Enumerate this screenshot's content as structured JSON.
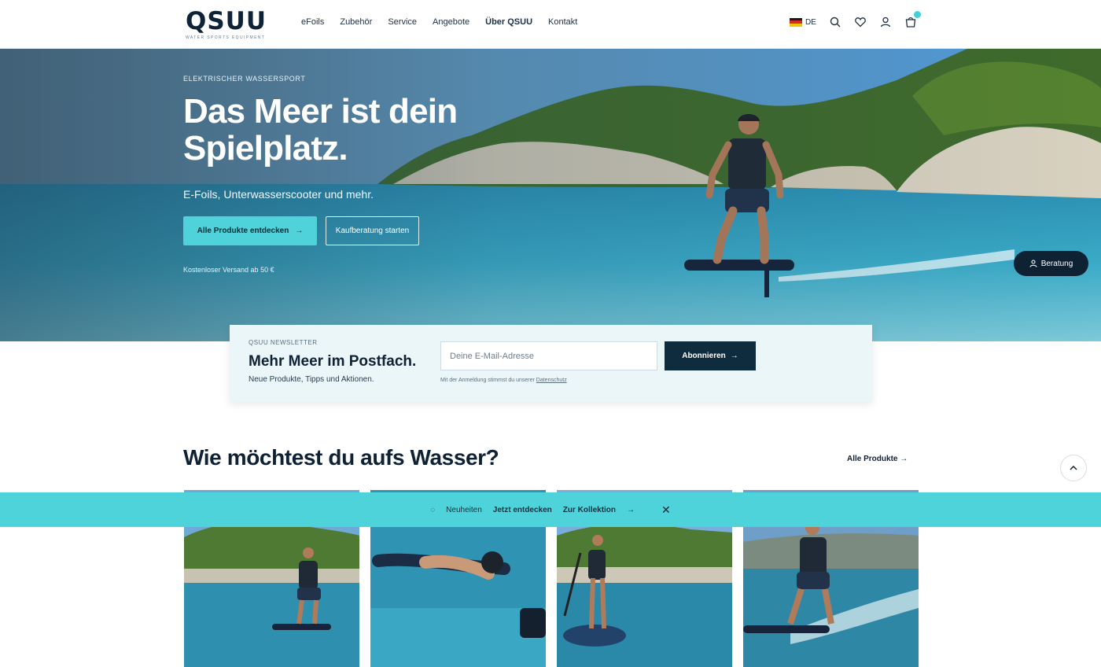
{
  "brand": {
    "name": "QSUU",
    "tagline": "WATER SPORTS EQUIPMENT"
  },
  "nav": {
    "items": [
      "eFoils",
      "Zubehör",
      "Service",
      "Angebote",
      "Über QSUU",
      "Kontakt"
    ]
  },
  "header": {
    "language": "DE",
    "icons": [
      "search-icon",
      "heart-icon",
      "user-icon",
      "cart-icon"
    ]
  },
  "hero": {
    "eyebrow": "ELEKTRISCHER WASSERSPORT",
    "title": "Das Meer ist dein Spielplatz.",
    "subtitle": "E-Foils, Unterwasserscooter und mehr.",
    "primary_cta": "Alle Produkte entdecken",
    "secondary_cta": "Kaufberatung starten",
    "note": "Kostenloser Versand ab 50 €",
    "float_button": "Beratung"
  },
  "newsletter": {
    "eyebrow": "QSUU NEWSLETTER",
    "title": "Mehr Meer im Postfach.",
    "subtitle": "Neue Produkte, Tipps und Aktionen.",
    "placeholder": "Deine E-Mail-Adresse",
    "button": "Abonnieren",
    "legal": "Mit der Anmeldung stimmst du unserer",
    "legal_link": "Datenschutz"
  },
  "section": {
    "title": "Wie möchtest du aufs Wasser?",
    "link": "Alle Produkte"
  },
  "banner": {
    "text": "Neuheiten",
    "cta": "Jetzt entdecken",
    "cta2": "Zur Kollektion"
  },
  "colors": {
    "accent": "#4fd3da",
    "navy": "#0f2235",
    "newsletter_bg": "#eaf6f7"
  }
}
